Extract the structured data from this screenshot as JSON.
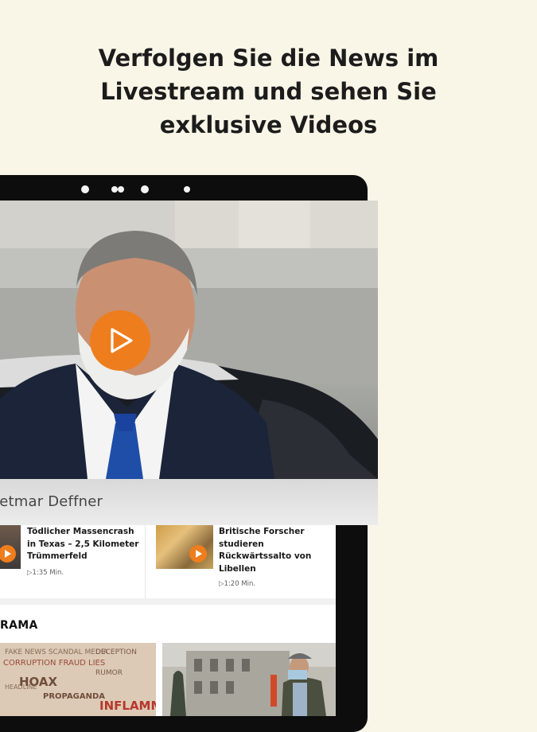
{
  "headline": {
    "line1": "Verfolgen Sie die News im",
    "line2": "Livestream und sehen Sie",
    "line3": "exklusive Videos"
  },
  "video": {
    "caption": "ietmar Deffner",
    "play_icon": "play-icon"
  },
  "teasers": [
    {
      "title_lines": [
        "Tödlicher Massencrash",
        "in Texas – 2,5 Kilometer",
        "Trümmerfeld"
      ],
      "duration": "▷1:35 Min."
    },
    {
      "title_lines": [
        "Britische Forscher",
        "studieren",
        "Rückwärtssalto von",
        "Libellen"
      ],
      "duration": "▷1:20 Min."
    }
  ],
  "section": {
    "title": "RAMA"
  },
  "thumb_words": [
    "HOAX",
    "PROPAGANDA",
    "INFLAMMA"
  ],
  "colors": {
    "accent": "#ee7d1d",
    "background": "#faf6e7"
  }
}
